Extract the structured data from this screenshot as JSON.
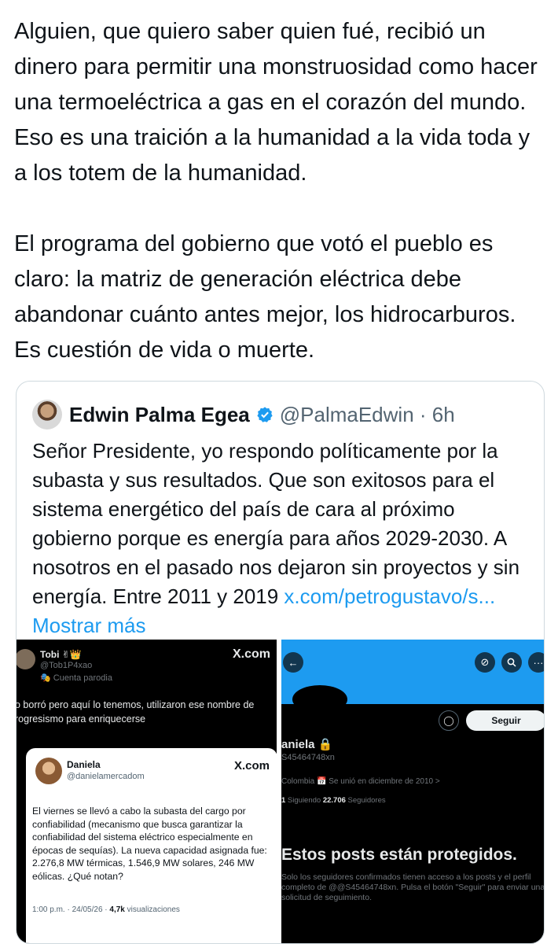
{
  "post": {
    "text": "Alguien, que quiero saber quien fué, recibió un dinero para permitir una monstruosidad como hacer una termoeléctrica a gas en el corazón del mundo. Eso es una traición a la  humanidad a la vida toda y a los totem de la humanidad.\n\nEl programa del gobierno que votó el pueblo es claro: la matriz de generación eléctrica debe abandonar cuánto antes mejor, los hidrocarburos. Es cuestión de vida o muerte."
  },
  "quote": {
    "author_name": "Edwin Palma Egea",
    "handle_time": "@PalmaEdwin · 6h",
    "body": "Señor Presidente, yo respondo políticamente por la subasta y sus resultados. Que son exitosos para el sistema energético del país de cara al próximo gobierno porque es energía para años 2029-2030. A nosotros en el pasado nos dejaron sin proyectos y sin energía. Entre 2011 y 2019 ",
    "link_text": "x.com/petrogustavo/s...",
    "show_more": " Mostrar más"
  },
  "left_image": {
    "name": "Tobi ✌👑",
    "handle": "@Tob1P4xao",
    "parody": "🎭 Cuenta parodia",
    "brand": "X.com",
    "text": "o borró pero aquí lo tenemos, utilizaron ese nombre de rogresismo para enriquecerse",
    "inner": {
      "name": "Daniela",
      "handle": "@danielamercadom",
      "brand": "X.com",
      "text": "El viernes se llevó a cabo la subasta del cargo por confiabilidad (mecanismo que busca garantizar la confiabilidad del sistema eléctrico especialmente en épocas de sequías). La nueva capacidad asignada fue: 2.276,8 MW térmicas, 1.546,9 MW solares, 246 MW eólicas. ¿Qué notan?",
      "meta_time": "1:00 p.m. · 24/05/26 · ",
      "meta_views": "4,7k",
      "meta_views_label": " visualizaciones"
    }
  },
  "right_image": {
    "follow_button": "Seguir",
    "name": "aniela 🔒",
    "handle": "S45464748xn",
    "info": "Colombia   📅 Se unió en diciembre de 2010 >",
    "following_count": "1",
    "following_label": " Siguiendo  ",
    "followers_count": "22.706",
    "followers_label": " Seguidores",
    "protected_title": "Estos posts están protegidos.",
    "protected_desc": "Solo los seguidores confirmados tienen acceso a los posts y el perfil completo de @@S45464748xn. Pulsa el botón \"Seguir\" para enviar una solicitud de seguimiento."
  },
  "colors": {
    "link": "#1d9bf0",
    "banner": "#1d9bf0",
    "verified": "#1d9bf0"
  }
}
